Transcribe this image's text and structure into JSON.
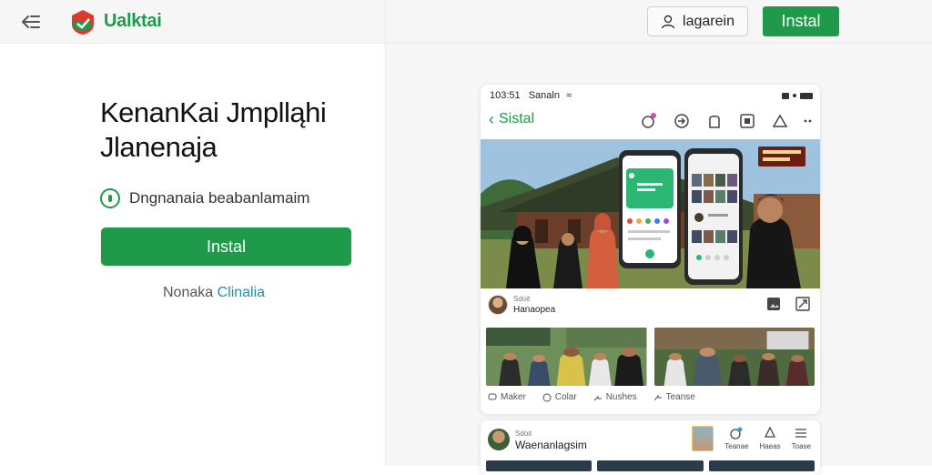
{
  "header": {
    "logo_text": "Ualktai",
    "login_label": "lagarein",
    "install_label": "Instal"
  },
  "hero": {
    "headline_line1": "KenanKai Jmplląhi",
    "headline_line2": "Jlanenaja",
    "tagline": "Dngnanaia beabanlamaim",
    "install_label": "Instal",
    "link_prefix": "Nonaka ",
    "link_accent": "Clinalia"
  },
  "preview": {
    "status_time": "103:51",
    "status_carrier": "Sanaln",
    "app_title": "Sistal",
    "post_author_small": "Sdoit",
    "post_author": "Hanaopea",
    "actions": [
      "Maker",
      "Colar",
      "Nushes",
      "Teanse"
    ],
    "card2_small": "Sdoit",
    "card2_author": "Waenanlagsim",
    "card2_labels": [
      "Teanae",
      "Haeas",
      "Toase"
    ]
  },
  "colors": {
    "brand_green": "#1f9a4a",
    "link_blue": "#1a8fb5",
    "logo_red": "#d93a2b"
  },
  "icons": [
    "back-arrow-icon",
    "logo-icon",
    "user-icon",
    "info-icon",
    "chevron-left-icon",
    "notification-icon",
    "share-icon",
    "bookmark-icon",
    "grid-icon",
    "triangle-icon",
    "more-icon",
    "comment-icon",
    "forward-icon",
    "image-icon",
    "expand-icon"
  ]
}
